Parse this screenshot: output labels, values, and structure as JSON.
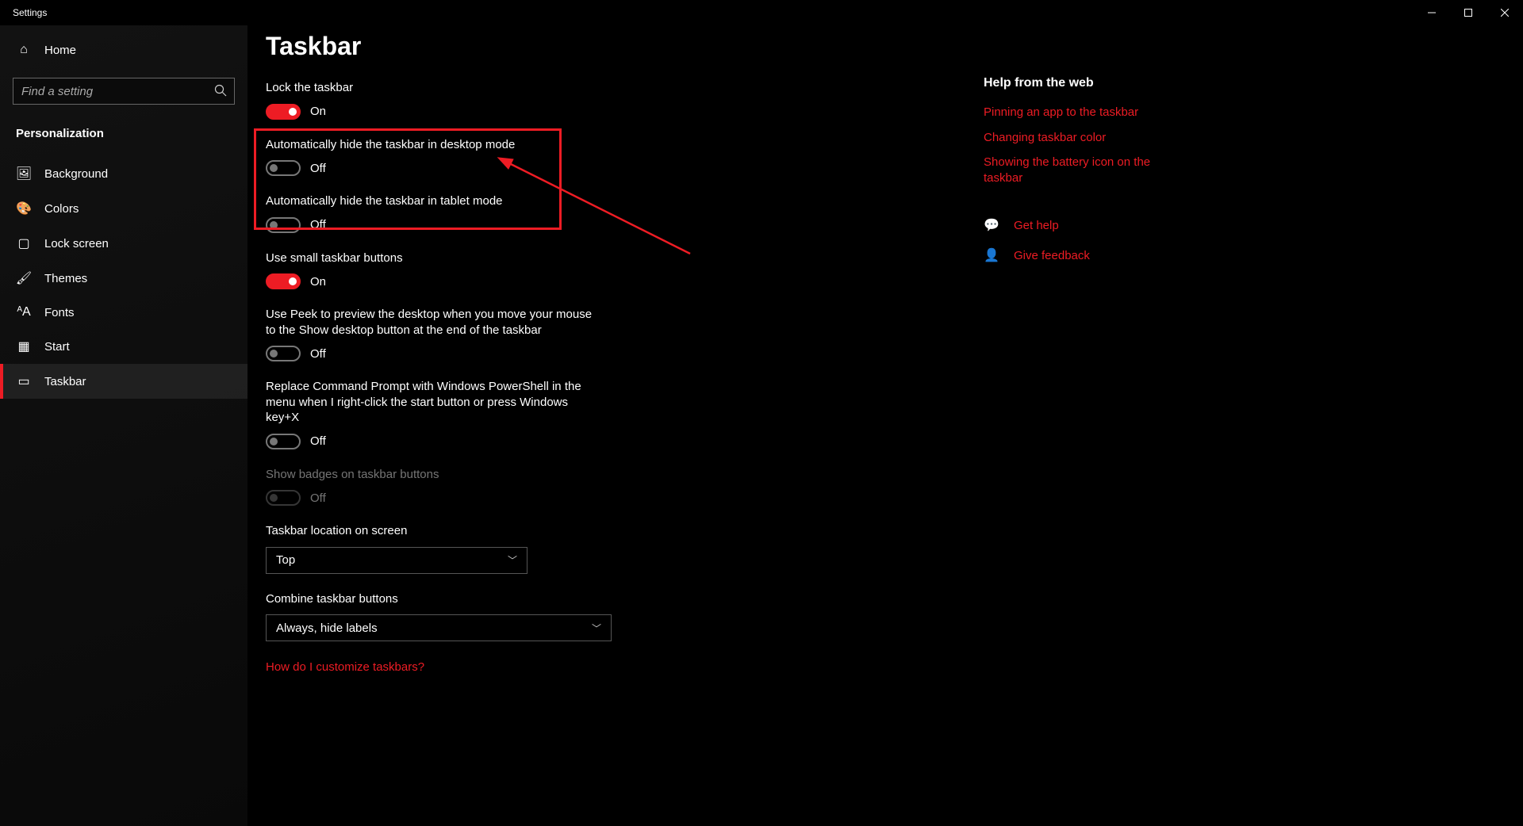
{
  "window": {
    "title": "Settings"
  },
  "sidebar": {
    "home": "Home",
    "search_placeholder": "Find a setting",
    "section": "Personalization",
    "items": [
      {
        "label": "Background",
        "icon": "image"
      },
      {
        "label": "Colors",
        "icon": "palette"
      },
      {
        "label": "Lock screen",
        "icon": "lock"
      },
      {
        "label": "Themes",
        "icon": "brush"
      },
      {
        "label": "Fonts",
        "icon": "font"
      },
      {
        "label": "Start",
        "icon": "grid"
      },
      {
        "label": "Taskbar",
        "icon": "taskbar"
      }
    ]
  },
  "page": {
    "title": "Taskbar"
  },
  "settings": {
    "lock": {
      "label": "Lock the taskbar",
      "state": "On",
      "on": true
    },
    "hide_desktop": {
      "label": "Automatically hide the taskbar in desktop mode",
      "state": "Off",
      "on": false
    },
    "hide_tablet": {
      "label": "Automatically hide the taskbar in tablet mode",
      "state": "Off",
      "on": false
    },
    "small": {
      "label": "Use small taskbar buttons",
      "state": "On",
      "on": true
    },
    "peek": {
      "label": "Use Peek to preview the desktop when you move your mouse to the Show desktop button at the end of the taskbar",
      "state": "Off",
      "on": false
    },
    "powershell": {
      "label": "Replace Command Prompt with Windows PowerShell in the menu when I right-click the start button or press Windows key+X",
      "state": "Off",
      "on": false
    },
    "badges": {
      "label": "Show badges on taskbar buttons",
      "state": "Off",
      "on": false
    },
    "location": {
      "label": "Taskbar location on screen",
      "value": "Top"
    },
    "combine": {
      "label": "Combine taskbar buttons",
      "value": "Always, hide labels"
    },
    "customize_link": "How do I customize taskbars?"
  },
  "help": {
    "header": "Help from the web",
    "links": [
      "Pinning an app to the taskbar",
      "Changing taskbar color",
      "Showing the battery icon on the taskbar"
    ],
    "get_help": "Get help",
    "feedback": "Give feedback"
  },
  "accent": "#ed1c24"
}
